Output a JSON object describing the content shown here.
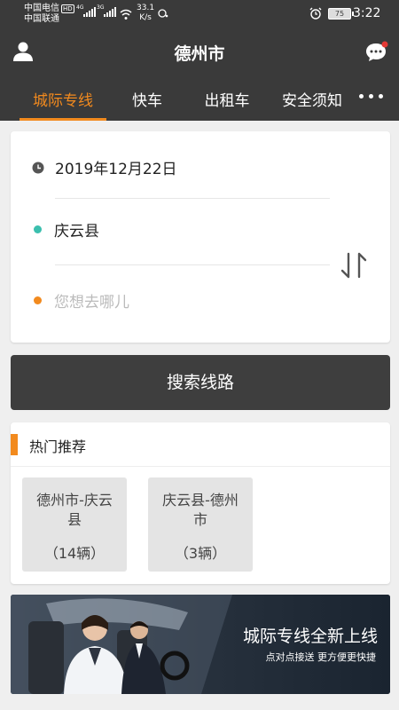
{
  "status_bar": {
    "carrier_1": "中国电信",
    "carrier_1_badge": "HD",
    "carrier_2": "中国联通",
    "net_1": "4G",
    "net_2": "3G",
    "speed_value": "33.1",
    "speed_unit": "K/s",
    "battery": "75",
    "time": "3:22"
  },
  "header": {
    "title": "德州市",
    "left_icon": "user-icon",
    "right_icon": "message-icon"
  },
  "tabs": [
    {
      "label": "城际专线",
      "active": true
    },
    {
      "label": "快车",
      "active": false
    },
    {
      "label": "出租车",
      "active": false
    },
    {
      "label": "安全须知",
      "active": false
    }
  ],
  "search": {
    "date": "2019年12月22日",
    "origin": "庆云县",
    "destination_placeholder": "您想去哪儿",
    "origin_dot_color": "#3bbfae",
    "destination_dot_color": "#f28a1e"
  },
  "search_button": "搜索线路",
  "hot": {
    "title": "热门推荐",
    "routes": [
      {
        "name": "德州市-庆云县",
        "count": "（14辆）"
      },
      {
        "name": "庆云县-德州市",
        "count": "（3辆）"
      }
    ]
  },
  "banner": {
    "title": "城际专线全新上线",
    "subtitle": "点对点接送   更方便更快捷"
  },
  "colors": {
    "accent": "#f28a1e",
    "header_bg": "#3a3a3a"
  }
}
